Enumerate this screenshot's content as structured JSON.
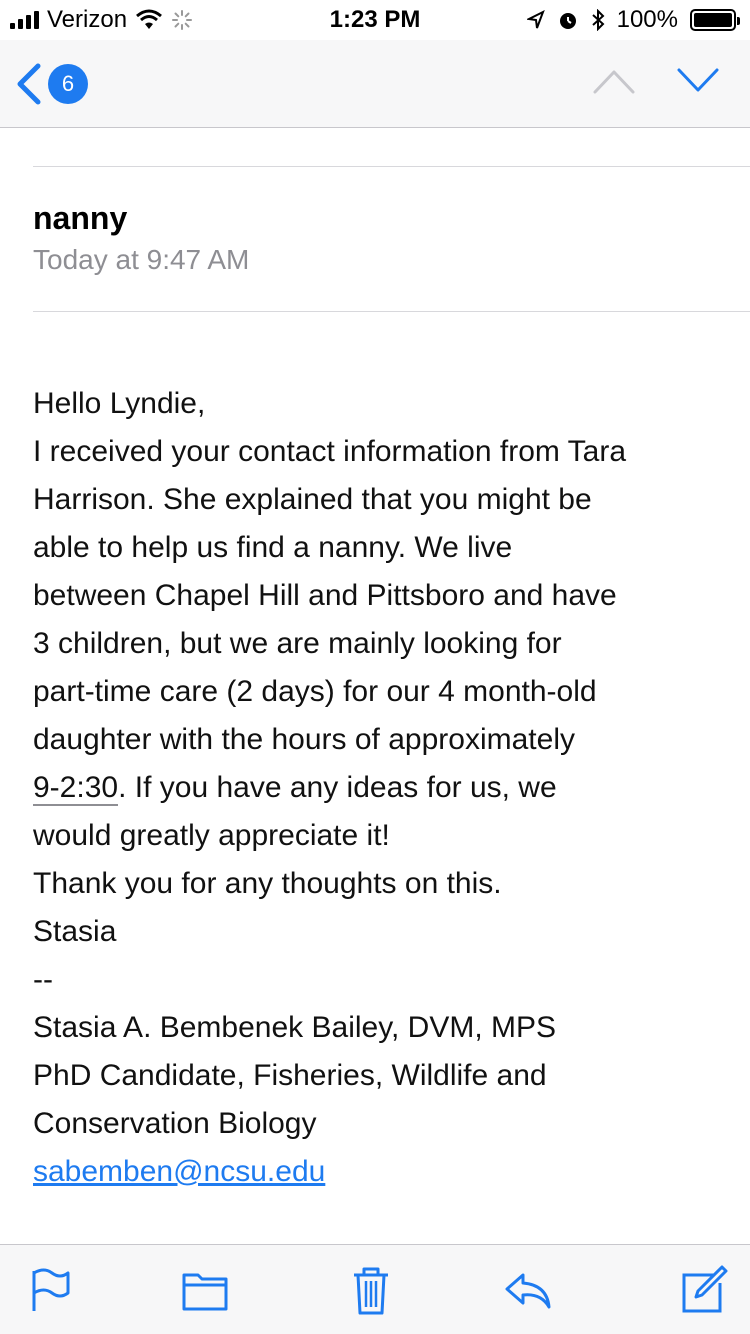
{
  "status_bar": {
    "carrier": "Verizon",
    "time": "1:23 PM",
    "battery": "100%"
  },
  "nav": {
    "back_badge": "6",
    "accent": "#1e7bf0"
  },
  "message": {
    "subject": "nanny",
    "date": "Today at 9:47 AM",
    "body_lines": [
      "Hello Lyndie,",
      "I received your contact information from Tara",
      "Harrison.  She explained that you might be",
      "able to help us find a nanny.  We live",
      "between Chapel Hill and Pittsboro and have",
      "3 children, but we are mainly looking for",
      "part-time care (2 days) for our 4 month-old",
      "daughter with the hours of approximately"
    ],
    "time_highlight": "9-2:30",
    "time_line_rest": ".  If you have any ideas for us, we",
    "body_lines_2": [
      "would greatly appreciate it!",
      "Thank you for any thoughts on this.",
      "Stasia",
      "--",
      "Stasia A. Bembenek Bailey, DVM, MPS",
      "PhD Candidate, Fisheries, Wildlife and",
      "Conservation Biology"
    ],
    "email": "sabemben@ncsu.edu"
  },
  "toolbar": {
    "icons": [
      "flag-icon",
      "folder-icon",
      "trash-icon",
      "reply-icon",
      "compose-icon"
    ]
  }
}
